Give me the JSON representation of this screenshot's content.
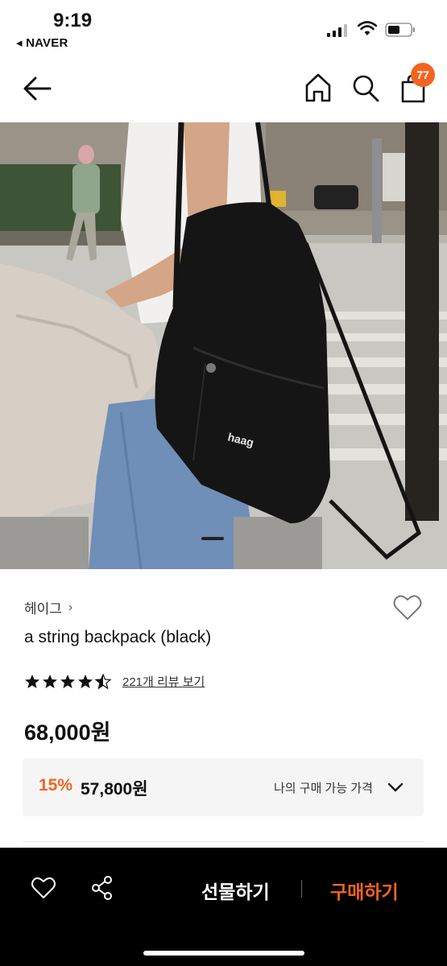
{
  "status_bar": {
    "time": "9:19",
    "back_app": "◂ NAVER"
  },
  "header": {
    "cart_count": "77"
  },
  "product": {
    "brand": "헤이그",
    "brand_chevron": "›",
    "name": "a string backpack (black)",
    "rating": 4.5,
    "review_link": "221개 리뷰 보기",
    "price": "68,000원",
    "discount_percent": "15%",
    "discount_price": "57,800원",
    "my_price_label": "나의 구매 가능 가격",
    "image_bag_text": "haag"
  },
  "bottom_bar": {
    "gift_label": "선물하기",
    "buy_label": "구매하기"
  },
  "colors": {
    "accent": "#f26322",
    "bottom_bar": "#000000",
    "price_box": "#f5f5f5"
  },
  "icons": [
    "back-arrow-icon",
    "home-icon",
    "search-icon",
    "cart-icon",
    "heart-icon",
    "star-icon",
    "chevron-down-icon",
    "share-icon"
  ]
}
